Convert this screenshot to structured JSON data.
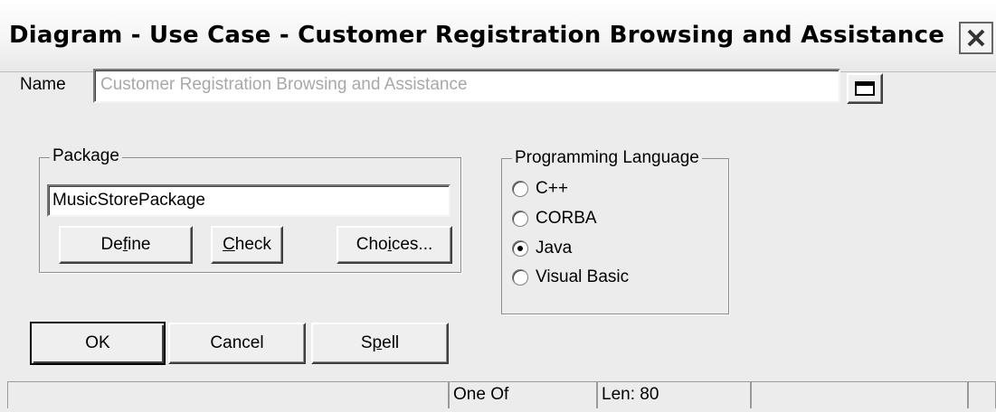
{
  "window": {
    "title": "Diagram - Use Case - Customer Registration Browsing and Assistance"
  },
  "name_field": {
    "label": "Name",
    "value": "Customer Registration Browsing and Assistance"
  },
  "package": {
    "group_label": "Package",
    "value": "MusicStorePackage",
    "buttons": {
      "define": "Define",
      "check": "Check",
      "choices": "Choices..."
    }
  },
  "programming_language": {
    "group_label": "Programming Language",
    "options": [
      "C++",
      "CORBA",
      "Java",
      "Visual Basic"
    ],
    "selected": "Java"
  },
  "actions": {
    "ok": "OK",
    "cancel": "Cancel",
    "spell": "Spell"
  },
  "statusbar": {
    "cells": [
      "",
      "One Of",
      "Len: 80",
      "",
      ""
    ]
  },
  "icons": {
    "close": "close-icon",
    "expand": "maximize-icon",
    "radio": "radio-icon"
  }
}
